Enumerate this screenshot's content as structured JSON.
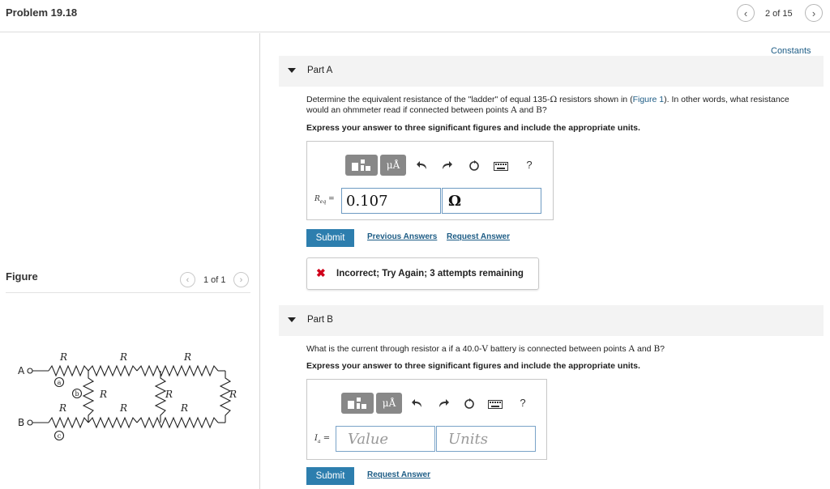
{
  "header": {
    "title": "Problem 19.18",
    "pager": {
      "prev_icon": "chevron-left-icon",
      "text": "2 of 15",
      "next_icon": "chevron-right-icon"
    }
  },
  "figure_panel": {
    "title": "Figure",
    "pager_text": "1 of 1",
    "circuit": {
      "resistor_label": "R",
      "terminals": [
        "A",
        "B"
      ],
      "points": [
        "a",
        "b",
        "c"
      ]
    }
  },
  "constants_link": "Constants",
  "part_a": {
    "label": "Part A",
    "question_1": "Determine the equivalent resistance of the \"ladder\" of equal 135-",
    "ohm": "Ω",
    "question_2": " resistors shown in (",
    "figure_link": "Figure 1",
    "question_3": "). In other words, what resistance",
    "question_line2a": "would an ohmmeter read if connected between points ",
    "point_a": "A",
    "and": " and ",
    "point_b": "B",
    "qmark": "?",
    "instruction": "Express your answer to three significant figures and include the appropriate units.",
    "var_label": "R",
    "var_sub": "eq",
    "equals": "=",
    "value": "0.107",
    "units": "Ω",
    "submit": "Submit",
    "previous_answers": "Previous Answers",
    "request_answer": "Request Answer",
    "feedback": "Incorrect; Try Again; 3 attempts remaining"
  },
  "part_b": {
    "label": "Part B",
    "question_1": "What is the current through resistor a if a 40.0-",
    "volt": "V",
    "question_2": " battery is connected between points ",
    "point_a": "A",
    "and": " and ",
    "point_b": "B",
    "qmark": "?",
    "instruction": "Express your answer to three significant figures and include the appropriate units.",
    "var_label": "I",
    "var_sub": "a",
    "equals": "=",
    "value_placeholder": "Value",
    "units_placeholder": "Units",
    "submit": "Submit",
    "request_answer": "Request Answer"
  },
  "toolbar": {
    "mu_label": "μÅ",
    "help_label": "?",
    "icons": [
      "templates-icon",
      "units-icon",
      "undo-icon",
      "redo-icon",
      "reset-icon",
      "keyboard-icon",
      "help-icon"
    ]
  }
}
